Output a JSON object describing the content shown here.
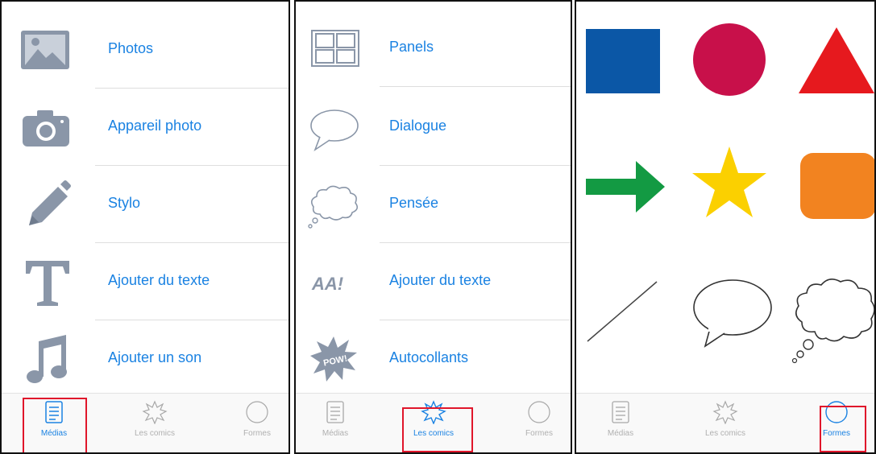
{
  "screens": [
    {
      "items": [
        {
          "label": "Photos",
          "icon": "image-icon"
        },
        {
          "label": "Appareil photo",
          "icon": "camera-icon"
        },
        {
          "label": "Stylo",
          "icon": "pencil-icon"
        },
        {
          "label": "Ajouter du texte",
          "icon": "text-t-icon"
        },
        {
          "label": "Ajouter un son",
          "icon": "music-note-icon"
        }
      ],
      "active_tab": 0
    },
    {
      "items": [
        {
          "label": "Panels",
          "icon": "panels-grid-icon"
        },
        {
          "label": "Dialogue",
          "icon": "speech-bubble-icon"
        },
        {
          "label": "Pensée",
          "icon": "thought-bubble-icon"
        },
        {
          "label": "Ajouter du texte",
          "icon": "comic-text-icon",
          "icon_text": "AA!"
        },
        {
          "label": "Autocollants",
          "icon": "pow-sticker-icon",
          "icon_text": "POW!"
        }
      ],
      "active_tab": 1
    },
    {
      "shapes": [
        {
          "name": "blue-square",
          "color": "#0b57a6"
        },
        {
          "name": "red-circle",
          "color": "#c8104a"
        },
        {
          "name": "red-triangle",
          "color": "#e6191e"
        },
        {
          "name": "green-arrow",
          "color": "#139a43"
        },
        {
          "name": "yellow-star",
          "color": "#fbd000"
        },
        {
          "name": "orange-rounded-square",
          "color": "#f28320"
        },
        {
          "name": "diagonal-line",
          "color": "#444444"
        },
        {
          "name": "speech-bubble-outline",
          "color": "#333333"
        },
        {
          "name": "thought-cloud-outline",
          "color": "#333333"
        }
      ],
      "active_tab": 2
    }
  ],
  "tabs": [
    {
      "label": "Médias",
      "icon": "list-icon"
    },
    {
      "label": "Les comics",
      "icon": "burst-icon"
    },
    {
      "label": "Formes",
      "icon": "circle-icon"
    }
  ],
  "colors": {
    "accent": "#1a82e2",
    "icon_gray": "#8a96a8",
    "highlight": "#e0162b"
  }
}
